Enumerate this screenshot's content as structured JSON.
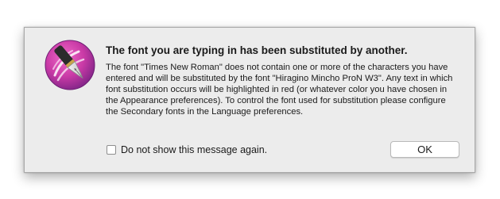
{
  "dialog": {
    "title": "The font you are typing in has been substituted by another.",
    "message": "The font \"Times New Roman\" does not contain one or more of the characters you have entered and will be substituted by the font \"Hiragino Mincho ProN W3\". Any text in which font substitution occurs will be highlighted in red (or whatever color you have chosen in the Appearance preferences). To control the font used for substitution please configure the Secondary fonts in the Language preferences.",
    "icon": "fountain-pen-app-icon",
    "checkbox": {
      "label": "Do not show this message again.",
      "checked": false
    },
    "ok_label": "OK"
  },
  "colors": {
    "dialog_background": "#ececec",
    "icon_pink": "#d23fa8",
    "icon_purple": "#8a2c8f"
  }
}
